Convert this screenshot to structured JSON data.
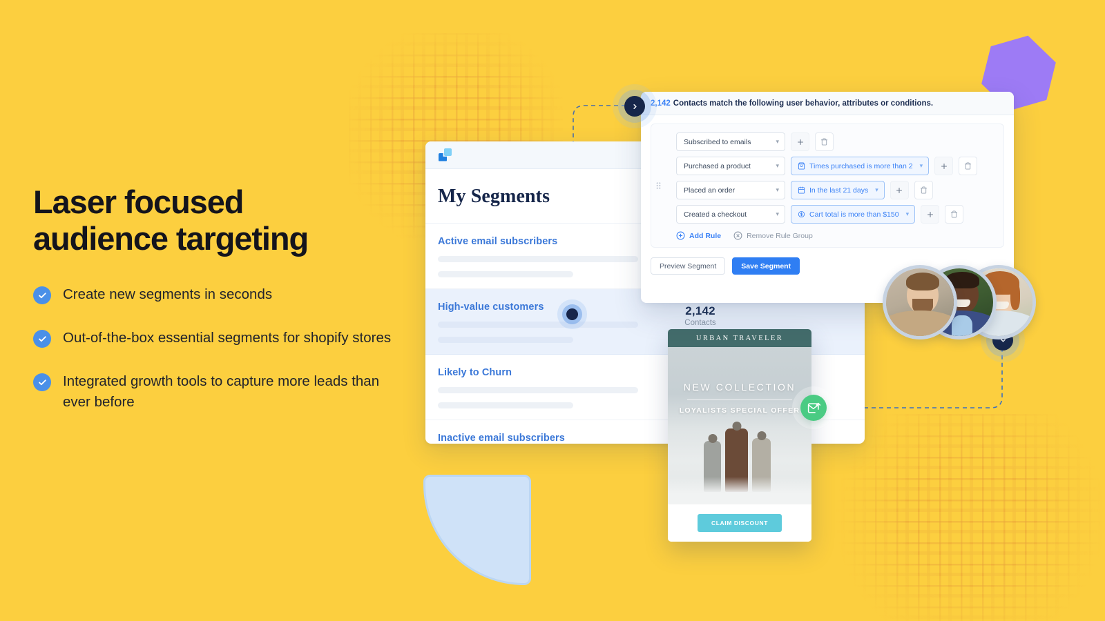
{
  "theme": {
    "background": "#FCCF3F",
    "accent_blue": "#3B82F6",
    "navy": "#16264A",
    "green": "#4ACB83",
    "purple": "#9D7BF5",
    "light_blue": "#CFE2F8"
  },
  "copy": {
    "headline_line1": "Laser focused",
    "headline_line2": "audience targeting",
    "bullets": [
      "Create new segments in seconds",
      "Out-of-the-box essential segments for shopify stores",
      "Integrated growth tools to capture more leads than ever before"
    ]
  },
  "segments_panel": {
    "title": "My Segments",
    "rows": [
      {
        "label": "Active email subscribers",
        "active": false
      },
      {
        "label": "High-value customers",
        "active": true
      },
      {
        "label": "Likely to Churn",
        "active": false
      },
      {
        "label": "Inactive email subscribers",
        "active": false
      }
    ]
  },
  "stat": {
    "value": "2,142",
    "label": "Contacts"
  },
  "builder": {
    "header_count": "2,142",
    "header_text": "Contacts match the following user behavior, attributes or conditions.",
    "rules": [
      {
        "condition": "Subscribed to emails",
        "filter": null,
        "filter_icon": null,
        "add_label": "+",
        "delete_label": "delete"
      },
      {
        "condition": "Purchased a product",
        "filter": "Times purchased is more than 2",
        "filter_icon": "shopping-bag-icon",
        "add_label": "+",
        "delete_label": "delete"
      },
      {
        "condition": "Placed an order",
        "filter": "In the last 21 days",
        "filter_icon": "calendar-icon",
        "add_label": "+",
        "delete_label": "delete"
      },
      {
        "condition": "Created a checkout",
        "filter": "Cart total is more than $150",
        "filter_icon": "dollar-circle-icon",
        "add_label": "+",
        "delete_label": "delete"
      }
    ],
    "add_rule_label": "Add Rule",
    "remove_rule_group_label": "Remove Rule Group",
    "preview_button": "Preview Segment",
    "save_button": "Save Segment"
  },
  "email_card": {
    "brand": "URBAN TRAVELER",
    "title": "NEW COLLECTION",
    "subtitle": "LOYALISTS SPECIAL OFFER",
    "cta": "CLAIM DISCOUNT"
  },
  "nav": {
    "next_icon": "chevron-right-icon",
    "down_icon": "chevron-down-icon",
    "send_icon": "send-email-icon"
  }
}
